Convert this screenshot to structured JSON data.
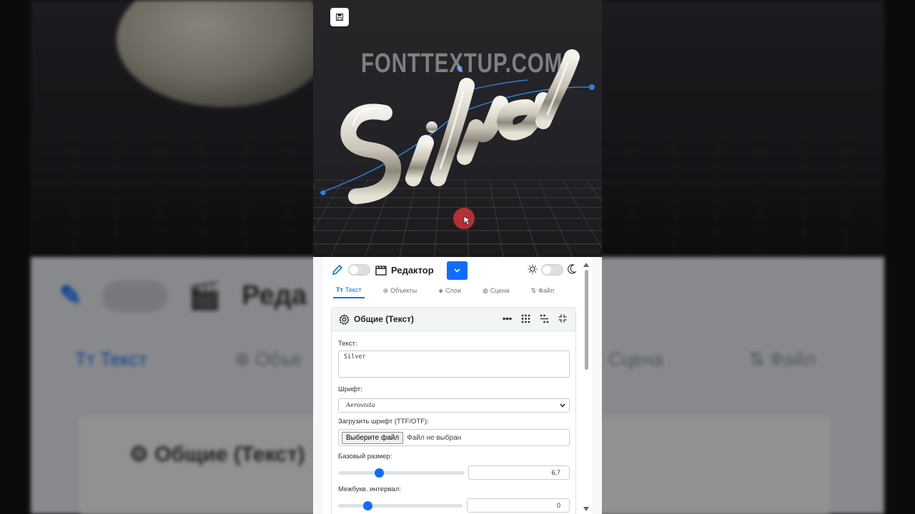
{
  "scene": {
    "watermark": "FONTTEXTUP.COM",
    "text_3d": "Silver"
  },
  "toolbar": {
    "title": "Редактор"
  },
  "tabs": [
    {
      "label": "Текст",
      "icon": "text-icon",
      "active": true
    },
    {
      "label": "Объекты",
      "icon": "plus-circle-icon"
    },
    {
      "label": "Слои",
      "icon": "layers-icon"
    },
    {
      "label": "Сцена",
      "icon": "globe-icon"
    },
    {
      "label": "Файл",
      "icon": "arrows-updown-icon"
    }
  ],
  "panel": {
    "title": "Общие (Текст)",
    "text_label": "Текст:",
    "text_value": "Silver",
    "font_label": "Шрифт:",
    "font_value": "Aerovista",
    "upload_label": "Загрузить шрифт (TTF/OTF):",
    "upload_button": "Выберите файл",
    "upload_status": "Файл не выбран",
    "size_label": "Базовый размер:",
    "size_value": "6,7",
    "size_fraction": 0.31,
    "spacing_label": "Межбукв. интервал:",
    "spacing_value": "0",
    "spacing_fraction": 0.22
  },
  "colors": {
    "accent": "#0d6efd",
    "scene_bg": "#232327"
  },
  "background_copy": {
    "title": "Реда",
    "tab_text": "Текст",
    "tab_objects": "Объе",
    "tab_scene": "Сцена",
    "tab_file": "Файл",
    "card_title": "Общие (Текст)"
  }
}
